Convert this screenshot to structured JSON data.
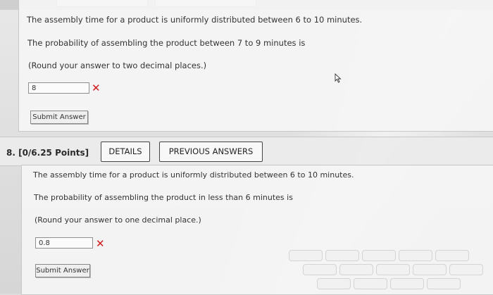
{
  "q7": {
    "statement": "The assembly time for a product is uniformly distributed between 6 to 10 minutes.",
    "question": "The probability of assembling the product between 7 to 9 minutes is",
    "instruction": "(Round your answer to two decimal places.)",
    "answer_value": "8",
    "result_icon": "x-mark-icon",
    "submit_label": "Submit Answer"
  },
  "q8": {
    "number_label": "8.  [0/6.25 Points]",
    "details_label": "DETAILS",
    "previous_answers_label": "PREVIOUS ANSWERS",
    "statement": "The assembly time for a product is uniformly distributed between 6 to 10 minutes.",
    "question": "The probability of assembling the product in less than 6 minutes is",
    "instruction": "(Round your answer to one decimal place.)",
    "answer_value": "0.8",
    "result_icon": "x-mark-icon",
    "submit_label": "Submit Answer"
  },
  "colors": {
    "wrong_mark": "#d21a1a",
    "panel_bg": "#f5f5f5",
    "border": "#444444"
  }
}
